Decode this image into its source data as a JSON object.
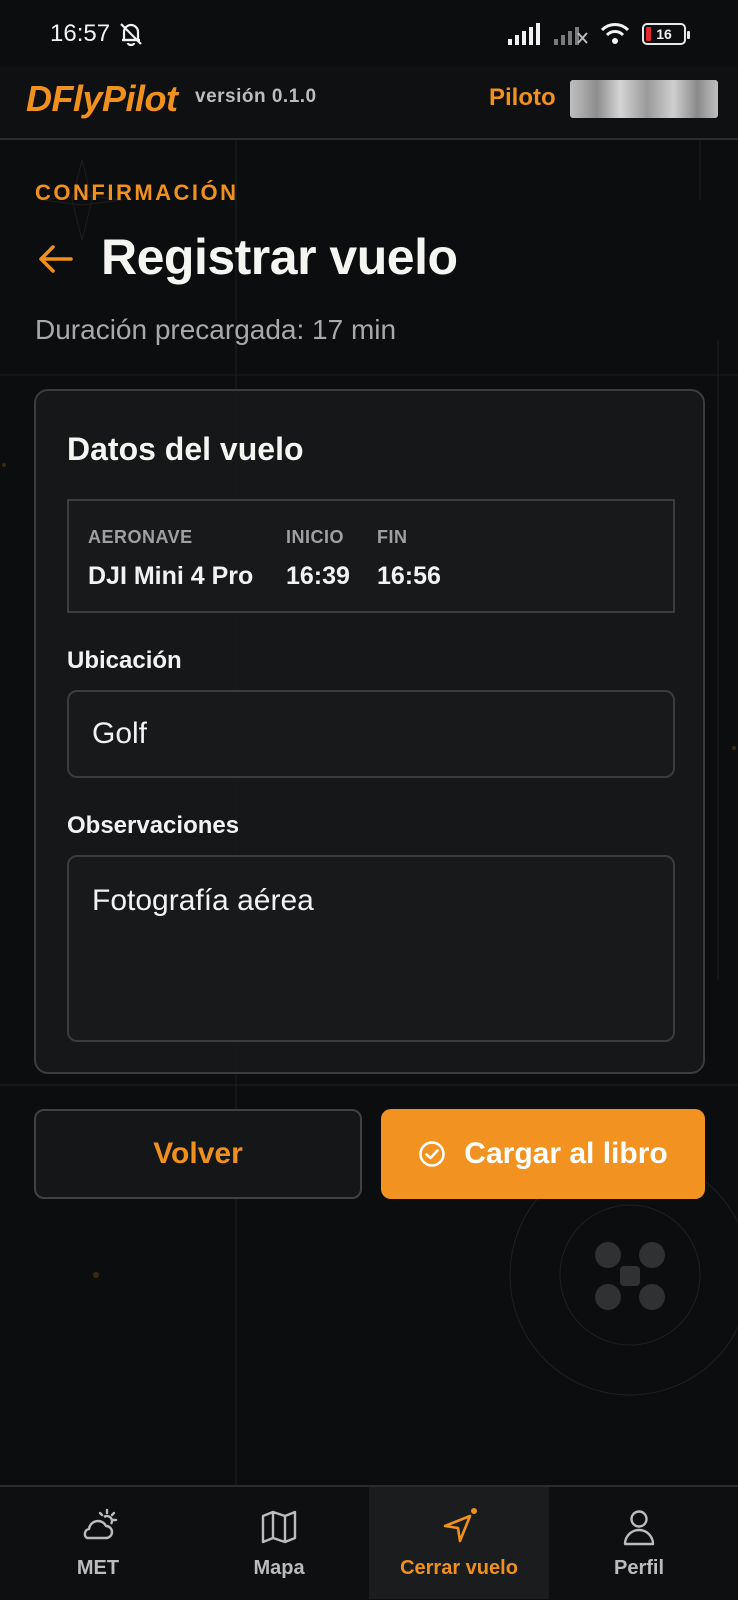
{
  "status_bar": {
    "time": "16:57",
    "battery": "16"
  },
  "header": {
    "brand": "DFlyPilot",
    "version": "versión 0.1.0",
    "pilot_label": "Piloto",
    "pilot_name": ""
  },
  "page": {
    "eyebrow": "CONFIRMACIÓN",
    "title": "Registrar vuelo",
    "subtitle": "Duración precargada: 17 min"
  },
  "card": {
    "title": "Datos del vuelo",
    "info": {
      "aircraft_label": "AERONAVE",
      "aircraft_value": "DJI Mini 4 Pro",
      "start_label": "INICIO",
      "start_value": "16:39",
      "end_label": "FIN",
      "end_value": "16:56"
    },
    "location_label": "Ubicación",
    "location_value": "Golf",
    "notes_label": "Observaciones",
    "notes_value": "Fotografía aérea"
  },
  "actions": {
    "back_label": "Volver",
    "submit_label": "Cargar al libro"
  },
  "nav": {
    "items": [
      {
        "label": "MET",
        "icon": "weather-icon"
      },
      {
        "label": "Mapa",
        "icon": "map-icon"
      },
      {
        "label": "Cerrar vuelo",
        "icon": "navigation-arrow-icon"
      },
      {
        "label": "Perfil",
        "icon": "user-icon"
      }
    ],
    "active_index": 2
  },
  "colors": {
    "accent": "#f0911e",
    "background": "#0c0d0e",
    "card": "#16181a",
    "border": "#3a3c3f",
    "battery_low": "#e32b2b"
  }
}
